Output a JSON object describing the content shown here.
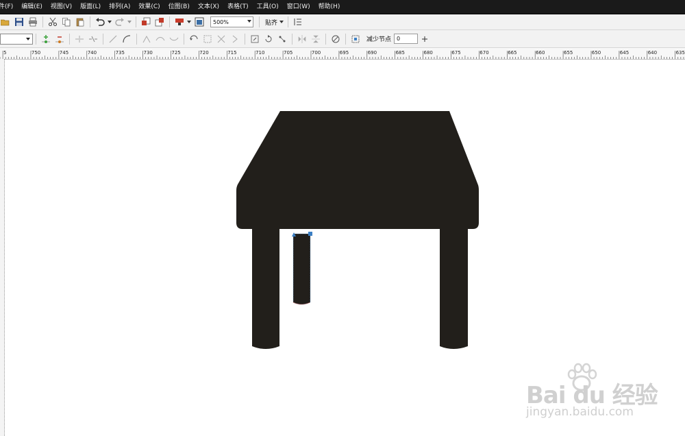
{
  "menu": [
    "件(F)",
    "编辑(E)",
    "视图(V)",
    "版面(L)",
    "排列(A)",
    "效果(C)",
    "位图(B)",
    "文本(X)",
    "表格(T)",
    "工具(O)",
    "窗口(W)",
    "帮助(H)"
  ],
  "toolbar": {
    "zoom_value": "500%",
    "snap_label": "贴齐"
  },
  "node_toolbar": {
    "reduce_nodes_label": "减少节点",
    "reduce_nodes_value": "0"
  },
  "ruler": {
    "labels": [
      "5",
      "750",
      "745",
      "740",
      "735",
      "730",
      "725",
      "720",
      "715",
      "710",
      "705",
      "700",
      "695",
      "690",
      "685",
      "680",
      "675",
      "670",
      "665",
      "660",
      "655",
      "650",
      "645",
      "640",
      "635"
    ]
  },
  "colors": {
    "shape_fill": "#221f1b",
    "selection_handle": "#3b7fc4",
    "menubar_bg": "#1a1a1a",
    "watermark": "#d0d0d0"
  },
  "watermark": {
    "brand": "Bai du 经验",
    "url": "jingyan.baidu.com"
  }
}
